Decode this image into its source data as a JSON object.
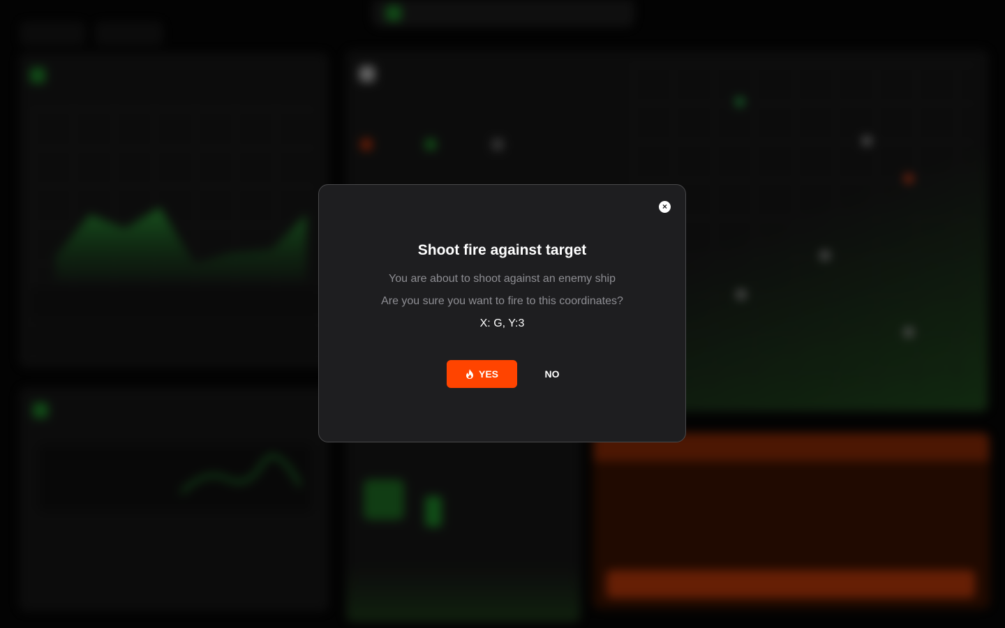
{
  "modal": {
    "title": "Shoot fire against target",
    "line1": "You are about to shoot against an enemy ship",
    "line2": "Are you sure you want to fire to this coordinates?",
    "coordinates": "X: G, Y:3",
    "yes_label": "YES",
    "no_label": "NO",
    "close_icon": "close-icon",
    "yes_icon": "flame-icon"
  },
  "colors": {
    "accent_orange": "#ff4400",
    "modal_bg": "#1e1e20",
    "muted_text": "#8e8e93",
    "accent_green": "#1f8a2a"
  }
}
